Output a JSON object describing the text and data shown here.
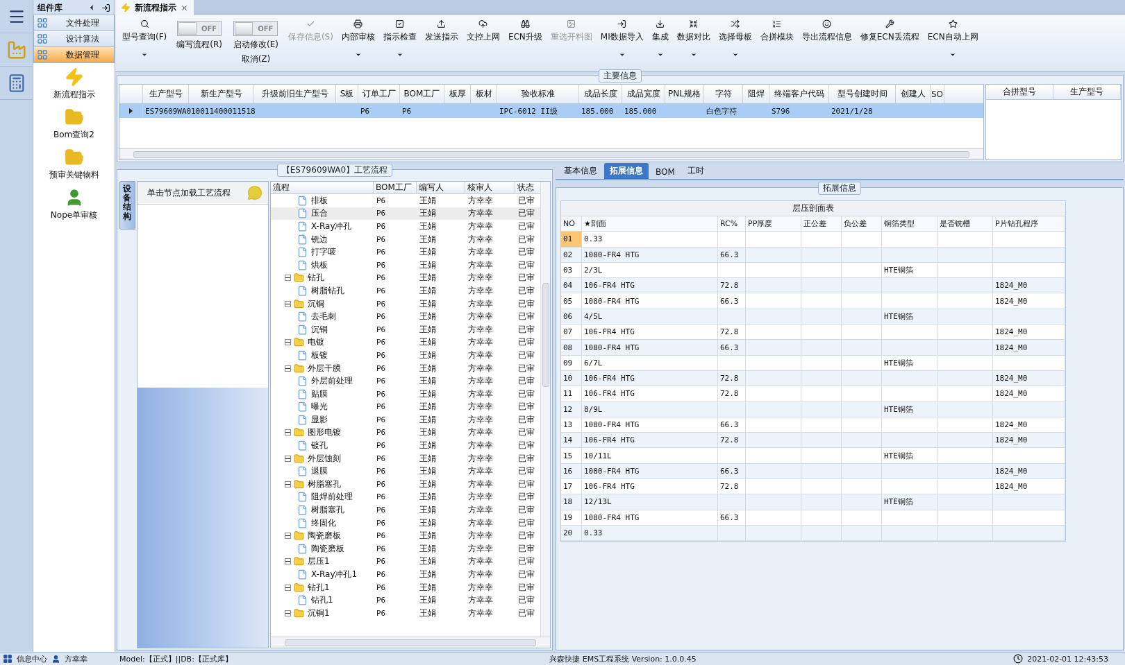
{
  "icon_rail": {
    "items": [
      {
        "selected": false
      },
      {
        "selected": false
      }
    ]
  },
  "component_library": {
    "title": "组件库",
    "nav": [
      {
        "label": "文件处理",
        "selected": false
      },
      {
        "label": "设计算法",
        "selected": false
      },
      {
        "label": "数据管理",
        "selected": true
      }
    ],
    "items": [
      {
        "label": "新流程指示"
      },
      {
        "label": "Bom查询2"
      },
      {
        "label": "预审关键物料"
      },
      {
        "label": "Nope单审核"
      }
    ]
  },
  "document_tab": {
    "title": "新流程指示"
  },
  "toolbar": [
    {
      "kind": "button",
      "label": "型号查询(F)",
      "dropdown": true,
      "disabled": false
    },
    {
      "kind": "toggle",
      "label": "编写流程(R)",
      "state_text": "OFF",
      "on": false
    },
    {
      "kind": "toggle",
      "label": "启动修改(E)",
      "label_2": "取消(Z)",
      "state_text": "OFF",
      "on": false
    },
    {
      "kind": "button",
      "label": "保存信息(S)",
      "dropdown": false,
      "disabled": true
    },
    {
      "kind": "button",
      "label": "内部审核",
      "dropdown": true,
      "disabled": false
    },
    {
      "kind": "button",
      "label": "指示检查",
      "dropdown": true,
      "disabled": false
    },
    {
      "kind": "button",
      "label": "发送指示",
      "dropdown": false,
      "disabled": false
    },
    {
      "kind": "button",
      "label": "文控上网",
      "dropdown": false,
      "disabled": false
    },
    {
      "kind": "button",
      "label": "ECN升级",
      "dropdown": false,
      "disabled": false
    },
    {
      "kind": "button",
      "label": "重选开料图",
      "dropdown": false,
      "disabled": true
    },
    {
      "kind": "button",
      "label": "MI数据导入",
      "dropdown": true,
      "disabled": false
    },
    {
      "kind": "button",
      "label": "集成",
      "dropdown": true,
      "disabled": false
    },
    {
      "kind": "button",
      "label": "数据对比",
      "dropdown": true,
      "disabled": false
    },
    {
      "kind": "button",
      "label": "选择母板",
      "dropdown": true,
      "disabled": false
    },
    {
      "kind": "button",
      "label": "合拼模块",
      "dropdown": false,
      "disabled": false
    },
    {
      "kind": "button",
      "label": "导出流程信息",
      "dropdown": false,
      "disabled": false
    },
    {
      "kind": "button",
      "label": "修复ECN丢流程",
      "dropdown": false,
      "disabled": false
    },
    {
      "kind": "button",
      "label": "ECN自动上网",
      "dropdown": true,
      "disabled": false
    }
  ],
  "main_info": {
    "title": "主要信息",
    "columns": [
      "生产型号",
      "新生产型号",
      "升级前旧生产型号",
      "S板",
      "订单工厂",
      "BOM工厂",
      "板厚",
      "板材",
      "验收标准",
      "成品长度",
      "成品宽度",
      "PNL规格",
      "字符",
      "阻焊",
      "终端客户代码",
      "型号创建时间",
      "创建人",
      "SO"
    ],
    "rows": [
      {
        "selected": true,
        "cells": [
          "ES79609WA0",
          "10011400011518",
          null,
          null,
          "P6",
          "P6",
          null,
          null,
          "IPC-6012 II级",
          "185.000",
          "185.000",
          null,
          "白色字符",
          null,
          "S796",
          "2021/1/28",
          null,
          null
        ]
      }
    ],
    "side_columns": [
      "合拼型号",
      "生产型号"
    ]
  },
  "process": {
    "title": "【ES79609WA0】工艺流程",
    "side_tab": "设备结构",
    "hint": "单击节点加载工艺流程",
    "columns": [
      "流程",
      "BOM工厂",
      "编写人",
      "核审人",
      "状态"
    ],
    "tree": [
      {
        "children": [
          {
            "label": "排板",
            "bom": "P6",
            "writer": "王娟",
            "reviewer": "方幸幸",
            "status": "已审",
            "selected": false
          },
          {
            "label": "压合",
            "bom": "P6",
            "writer": "王娟",
            "reviewer": "方幸幸",
            "status": "已审",
            "selected": true
          },
          {
            "label": "X-Ray冲孔",
            "bom": "P6",
            "writer": "王娟",
            "reviewer": "方幸幸",
            "status": "已审",
            "selected": false
          },
          {
            "label": "铣边",
            "bom": "P6",
            "writer": "王娟",
            "reviewer": "方幸幸",
            "status": "已审",
            "selected": false
          },
          {
            "label": "打字唛",
            "bom": "P6",
            "writer": "王娟",
            "reviewer": "方幸幸",
            "status": "已审",
            "selected": false
          },
          {
            "label": "烘板",
            "bom": "P6",
            "writer": "王娟",
            "reviewer": "方幸幸",
            "status": "已审",
            "selected": false
          }
        ]
      },
      {
        "label": "钻孔",
        "bom": "P6",
        "writer": "王娟",
        "reviewer": "方幸幸",
        "status": "已审",
        "selected": false,
        "expanded": true,
        "children": [
          {
            "label": "树脂钻孔",
            "bom": "P6",
            "writer": "王娟",
            "reviewer": "方幸幸",
            "status": "已审",
            "selected": false
          }
        ]
      },
      {
        "label": "沉铜",
        "bom": "P6",
        "writer": "王娟",
        "reviewer": "方幸幸",
        "status": "已审",
        "selected": false,
        "expanded": true,
        "children": [
          {
            "label": "去毛刺",
            "bom": "P6",
            "writer": "王娟",
            "reviewer": "方幸幸",
            "status": "已审",
            "selected": false
          },
          {
            "label": "沉铜",
            "bom": "P6",
            "writer": "王娟",
            "reviewer": "方幸幸",
            "status": "已审",
            "selected": false
          }
        ]
      },
      {
        "label": "电镀",
        "bom": "P6",
        "writer": "王娟",
        "reviewer": "方幸幸",
        "status": "已审",
        "selected": false,
        "expanded": true,
        "children": [
          {
            "label": "板镀",
            "bom": "P6",
            "writer": "王娟",
            "reviewer": "方幸幸",
            "status": "已审",
            "selected": false
          }
        ]
      },
      {
        "label": "外层干膜",
        "bom": "P6",
        "writer": "王娟",
        "reviewer": "方幸幸",
        "status": "已审",
        "selected": false,
        "expanded": true,
        "children": [
          {
            "label": "外层前处理",
            "bom": "P6",
            "writer": "王娟",
            "reviewer": "方幸幸",
            "status": "已审",
            "selected": false
          },
          {
            "label": "贴膜",
            "bom": "P6",
            "writer": "王娟",
            "reviewer": "方幸幸",
            "status": "已审",
            "selected": false
          },
          {
            "label": "曝光",
            "bom": "P6",
            "writer": "王娟",
            "reviewer": "方幸幸",
            "status": "已审",
            "selected": false
          },
          {
            "label": "显影",
            "bom": "P6",
            "writer": "王娟",
            "reviewer": "方幸幸",
            "status": "已审",
            "selected": false
          }
        ]
      },
      {
        "label": "图形电镀",
        "bom": "P6",
        "writer": "王娟",
        "reviewer": "方幸幸",
        "status": "已审",
        "selected": false,
        "expanded": true,
        "children": [
          {
            "label": "镀孔",
            "bom": "P6",
            "writer": "王娟",
            "reviewer": "方幸幸",
            "status": "已审",
            "selected": false
          }
        ]
      },
      {
        "label": "外层蚀刻",
        "bom": "P6",
        "writer": "王娟",
        "reviewer": "方幸幸",
        "status": "已审",
        "selected": false,
        "expanded": true,
        "children": [
          {
            "label": "退膜",
            "bom": "P6",
            "writer": "王娟",
            "reviewer": "方幸幸",
            "status": "已审",
            "selected": false
          }
        ]
      },
      {
        "label": "树脂塞孔",
        "bom": "P6",
        "writer": "王娟",
        "reviewer": "方幸幸",
        "status": "已审",
        "selected": false,
        "expanded": true,
        "children": [
          {
            "label": "阻焊前处理",
            "bom": "P6",
            "writer": "王娟",
            "reviewer": "方幸幸",
            "status": "已审",
            "selected": false
          },
          {
            "label": "树脂塞孔",
            "bom": "P6",
            "writer": "王娟",
            "reviewer": "方幸幸",
            "status": "已审",
            "selected": false
          },
          {
            "label": "终固化",
            "bom": "P6",
            "writer": "王娟",
            "reviewer": "方幸幸",
            "status": "已审",
            "selected": false
          }
        ]
      },
      {
        "label": "陶瓷磨板",
        "bom": "P6",
        "writer": "王娟",
        "reviewer": "方幸幸",
        "status": "已审",
        "selected": false,
        "expanded": true,
        "children": [
          {
            "label": "陶瓷磨板",
            "bom": "P6",
            "writer": "王娟",
            "reviewer": "方幸幸",
            "status": "已审",
            "selected": false
          }
        ]
      },
      {
        "label": "层压1",
        "bom": "P6",
        "writer": "王娟",
        "reviewer": "方幸幸",
        "status": "已审",
        "selected": false,
        "expanded": true,
        "children": [
          {
            "label": "X-Ray冲孔1",
            "bom": "P6",
            "writer": "王娟",
            "reviewer": "方幸幸",
            "status": "已审",
            "selected": false
          }
        ]
      },
      {
        "label": "钻孔1",
        "bom": "P6",
        "writer": "王娟",
        "reviewer": "方幸幸",
        "status": "已审",
        "selected": false,
        "expanded": true,
        "children": [
          {
            "label": "钻孔1",
            "bom": "P6",
            "writer": "王娟",
            "reviewer": "方幸幸",
            "status": "已审",
            "selected": false
          }
        ]
      },
      {
        "label": "沉铜1",
        "bom": "P6",
        "writer": "王娟",
        "reviewer": "方幸幸",
        "status": "已审",
        "selected": false,
        "expanded": true
      }
    ]
  },
  "details": {
    "tabs": [
      {
        "label": "基本信息",
        "selected": false
      },
      {
        "label": "拓展信息",
        "selected": true
      },
      {
        "label": "BOM",
        "selected": false
      },
      {
        "label": "工时",
        "selected": false
      }
    ],
    "group_title": "拓展信息",
    "table_title": "层压剖面表",
    "columns": [
      "NO",
      "★剖面",
      "RC%",
      "PP厚度",
      "正公差",
      "负公差",
      "铜箔类型",
      "是否铣槽",
      "P片钻孔程序"
    ],
    "rows": [
      {
        "no": "01",
        "section": "0.33",
        "selected": true
      },
      {
        "no": "02",
        "section": "1080-FR4 HTG",
        "rc": "66.3",
        "selected": false
      },
      {
        "no": "03",
        "section": "2/3L",
        "copper": "HTE铜箔",
        "selected": false
      },
      {
        "no": "04",
        "section": "106-FR4 HTG",
        "rc": "72.8",
        "program": "1824_M0",
        "selected": false
      },
      {
        "no": "05",
        "section": "1080-FR4 HTG",
        "rc": "66.3",
        "program": "1824_M0",
        "selected": false
      },
      {
        "no": "06",
        "section": "4/5L",
        "copper": "HTE铜箔",
        "selected": false
      },
      {
        "no": "07",
        "section": "106-FR4 HTG",
        "rc": "72.8",
        "program": "1824_M0",
        "selected": false
      },
      {
        "no": "08",
        "section": "1080-FR4 HTG",
        "rc": "66.3",
        "program": "1824_M0",
        "selected": false
      },
      {
        "no": "09",
        "section": "6/7L",
        "copper": "HTE铜箔",
        "selected": false
      },
      {
        "no": "10",
        "section": "106-FR4 HTG",
        "rc": "72.8",
        "program": "1824_M0",
        "selected": false
      },
      {
        "no": "11",
        "section": "106-FR4 HTG",
        "rc": "72.8",
        "program": "1824_M0",
        "selected": false
      },
      {
        "no": "12",
        "section": "8/9L",
        "copper": "HTE铜箔",
        "selected": false
      },
      {
        "no": "13",
        "section": "1080-FR4 HTG",
        "rc": "66.3",
        "program": "1824_M0",
        "selected": false
      },
      {
        "no": "14",
        "section": "106-FR4 HTG",
        "rc": "72.8",
        "program": "1824_M0",
        "selected": false
      },
      {
        "no": "15",
        "section": "10/11L",
        "copper": "HTE铜箔",
        "selected": false
      },
      {
        "no": "16",
        "section": "1080-FR4 HTG",
        "rc": "66.3",
        "program": "1824_M0",
        "selected": false
      },
      {
        "no": "17",
        "section": "106-FR4 HTG",
        "rc": "72.8",
        "program": "1824_M0",
        "selected": false
      },
      {
        "no": "18",
        "section": "12/13L",
        "copper": "HTE铜箔",
        "selected": false
      },
      {
        "no": "19",
        "section": "1080-FR4 HTG",
        "rc": "66.3",
        "selected": false
      },
      {
        "no": "20",
        "section": "0.33",
        "selected": false
      }
    ]
  },
  "status_bar": {
    "info_center": "信息中心",
    "user": "方幸幸",
    "environment": "Model:【正式】||DB:【正式库】",
    "product": "兴森快捷 EMS工程系统 Version: 1.0.0.45",
    "datetime": "2021-02-01 12:43:53"
  }
}
